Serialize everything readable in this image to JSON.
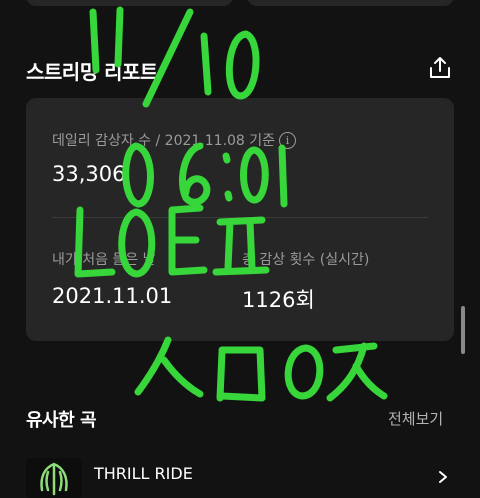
{
  "streaming_report": {
    "title": "스트리밍 리포트",
    "daily_listeners": {
      "label": "데일리 감상자 수 / 2021.11.08 기준",
      "value": "33,306"
    },
    "first_listen": {
      "label": "내가 처음 들은 날",
      "value": "2021.11.01"
    },
    "total_plays": {
      "label": "총 감상 횟수 (실시간)",
      "value": "1126회"
    }
  },
  "similar_songs": {
    "title": "유사한 곡",
    "see_all": "전체보기",
    "tracks": [
      {
        "title": "THRILL RIDE"
      }
    ]
  },
  "handwriting": {
    "lines": [
      "11/10",
      "06:01",
      "LOEㅍ",
      "ㅅㅁㅇㅈ"
    ],
    "color": "#37d63a"
  },
  "colors": {
    "background": "#121212",
    "card": "#262626",
    "secondary_text": "#9a9a9a"
  },
  "icons": {
    "share": "share-icon",
    "info": "info-icon",
    "chevron": "chevron-right-icon"
  }
}
